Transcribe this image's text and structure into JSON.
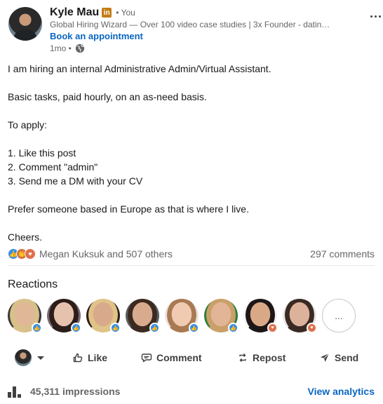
{
  "author": {
    "name": "Kyle Mau",
    "linkedin_badge": "in",
    "relation": "• You",
    "headline": "Global Hiring Wizard — Over 100 video case studies | 3x Founder - datin…",
    "cta": "Book an appointment",
    "posted": "1mo •",
    "visibility_icon": "globe-icon"
  },
  "post": {
    "lines": [
      "I am hiring an internal Administrative Admin/Virtual Assistant.",
      "",
      "Basic tasks, paid hourly, on an as-need basis.",
      "",
      "To apply:",
      "",
      "1. Like this post",
      "2. Comment \"admin\"",
      "3. Send me a DM with your CV",
      "",
      "Prefer someone based in Europe as that is where I live.",
      "",
      "Cheers."
    ]
  },
  "social": {
    "reactions_summary": "Megan Kuksuk and 507 others",
    "comments": "297 comments",
    "reaction_types": [
      "like",
      "celebrate",
      "love"
    ]
  },
  "reactions": {
    "heading": "Reactions",
    "reactors": [
      {
        "reaction": "like",
        "skin": "#e0b898",
        "hair": "#d8c08a",
        "bg": "#3a3a3a"
      },
      {
        "reaction": "like",
        "skin": "#e6c2ae",
        "hair": "#2b1d1a",
        "bg": "#7a6a72"
      },
      {
        "reaction": "like",
        "skin": "#d9a98c",
        "hair": "#e0c487",
        "bg": "#2a1e1e"
      },
      {
        "reaction": "like",
        "skin": "#d8ab8f",
        "hair": "#3c2a20",
        "bg": "#5a5f62"
      },
      {
        "reaction": "like",
        "skin": "#f0cbb2",
        "hair": "#a97a52",
        "bg": "#e9e4e2"
      },
      {
        "reaction": "like",
        "skin": "#e2b597",
        "hair": "#c9a069",
        "bg": "#2f7d3c"
      },
      {
        "reaction": "love",
        "skin": "#d8a887",
        "hair": "#1d1616",
        "bg": "#f2f2f2"
      },
      {
        "reaction": "love",
        "skin": "#dcb29a",
        "hair": "#3a2a24",
        "bg": "#e9e7e5"
      }
    ],
    "more_label": "..."
  },
  "actions": {
    "like": "Like",
    "comment": "Comment",
    "repost": "Repost",
    "send": "Send"
  },
  "footer": {
    "impressions": "45,311 impressions",
    "analytics": "View analytics"
  },
  "colors": {
    "link": "#0a66c2",
    "like": "#378fe9",
    "love": "#df704d",
    "premium_badge": "#c37d16"
  }
}
